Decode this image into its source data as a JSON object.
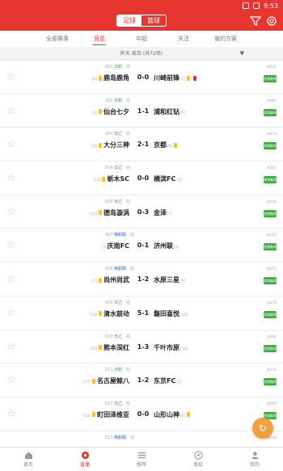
{
  "status": {
    "time": "9:53"
  },
  "header": {
    "seg_left": "足球",
    "seg_right": "篮球"
  },
  "tabs": [
    "全部赛事",
    "竞足",
    "中超",
    "关注",
    "我的方案"
  ],
  "date_bar": "昨天 周日 (共72场)",
  "matches": [
    {
      "meta_no": "001",
      "league": "日职",
      "status": "完",
      "home": "鹿岛鹿角",
      "home_rank": "[2]",
      "score": "0-0",
      "away": "川崎前锋",
      "away_rank": "[1]",
      "views": "631",
      "video": "视频集锦",
      "home_cards": [
        "y"
      ],
      "away_cards": [
        "y",
        "r"
      ]
    },
    {
      "meta_no": "002",
      "league": "日职",
      "status": "完",
      "home": "仙台七夕",
      "home_rank": "[9]",
      "score": "1-1",
      "away": "浦和红钻",
      "away_rank": "[6]",
      "views": "481",
      "video": "视频集锦",
      "home_cards": [
        "y"
      ],
      "away_cards": []
    },
    {
      "meta_no": "003",
      "league": "日乙",
      "status": "完",
      "home": "大分三神",
      "home_rank": "[3]",
      "score": "2-1",
      "away": "京都",
      "away_rank": "[8]",
      "views": "479",
      "video": "视频集锦",
      "home_cards": [
        "y"
      ],
      "away_cards": [
        "y"
      ]
    },
    {
      "meta_no": "004",
      "league": "日乙",
      "status": "完",
      "home": "栃木SC",
      "home_rank": "[11]",
      "score": "0-0",
      "away": "横滨FC",
      "away_rank": "[5]",
      "views": "287",
      "video": "视频集锦",
      "home_cards": [
        "y"
      ],
      "away_cards": []
    },
    {
      "meta_no": "005",
      "league": "日乙",
      "status": "完",
      "home": "德岛漩涡",
      "home_rank": "[12]",
      "score": "0-3",
      "away": "金泽",
      "away_rank": "[7]",
      "views": "246",
      "video": "视频集锦",
      "home_cards": [
        "y"
      ],
      "away_cards": []
    },
    {
      "meta_no": "007",
      "league": "韩职联",
      "status": "完",
      "home": "庆南FC",
      "home_rank": "[2]",
      "score": "0-1",
      "away": "济州联",
      "away_rank": "[4]",
      "views": "235",
      "video": "视频集锦",
      "home_cards": [],
      "away_cards": [],
      "blue": true
    },
    {
      "meta_no": "008",
      "league": "韩职联",
      "status": "完",
      "home": "尚州尚武",
      "home_rank": "[7]",
      "score": "1-2",
      "away": "水原三星",
      "away_rank": "[9]",
      "views": "245",
      "video": "视频集锦",
      "home_cards": [
        "y"
      ],
      "away_cards": [],
      "blue": true
    },
    {
      "meta_no": "009",
      "league": "日乙",
      "status": "完",
      "home": "清水鼓动",
      "home_rank": "[14]",
      "score": "5-1",
      "away": "磐田喜悦",
      "away_rank": "[15]",
      "views": "276",
      "video": "视频集锦",
      "home_cards": [
        "y"
      ],
      "away_cards": []
    },
    {
      "meta_no": "010",
      "league": "日乙",
      "status": "完",
      "home": "熊本深红",
      "home_rank": "[16]",
      "score": "1-3",
      "away": "千叶市原",
      "away_rank": "[10]",
      "views": "282",
      "video": "视频集锦",
      "home_cards": [
        "y"
      ],
      "away_cards": []
    },
    {
      "meta_no": "011",
      "league": "日职",
      "status": "完",
      "home": "名古屋鲸八",
      "home_rank": "[17]",
      "score": "1-2",
      "away": "东京FC",
      "away_rank": "[3]",
      "views": "331",
      "video": "视频集锦",
      "home_cards": [
        "y"
      ],
      "away_cards": []
    },
    {
      "meta_no": "012",
      "league": "日乙",
      "status": "完",
      "home": "町田泽维亚",
      "home_rank": "[13]",
      "score": "0-0",
      "away": "山形山神",
      "away_rank": "[4]",
      "views": "299",
      "video": "视频集锦",
      "home_cards": [
        "y"
      ],
      "away_cards": [
        "y"
      ]
    },
    {
      "meta_no": "013",
      "league": "韩职联",
      "status": "完",
      "home": "",
      "home_rank": "",
      "score": "",
      "away": "",
      "away_rank": "",
      "views": "204",
      "video": "",
      "home_cards": [],
      "away_cards": [],
      "blue": true,
      "partial": true
    }
  ],
  "bottom_nav": [
    "首页",
    "直播",
    "推荐",
    "发现",
    "我的"
  ],
  "colors": {
    "brand": "#e6362f",
    "video_badge": "#3caa3c",
    "yellow_card": "#f5c518"
  }
}
